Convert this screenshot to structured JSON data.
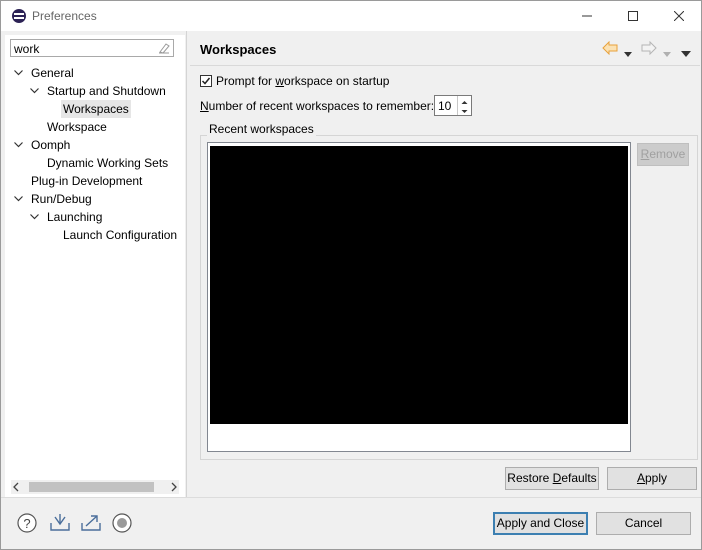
{
  "window": {
    "title": "Preferences"
  },
  "filter": {
    "value": "work"
  },
  "tree": [
    {
      "label": "General",
      "expanded": true
    },
    {
      "label": "Startup and Shutdown",
      "expanded": true
    },
    {
      "label": "Workspaces",
      "selected": true
    },
    {
      "label": "Workspace"
    },
    {
      "label": "Oomph",
      "expanded": true
    },
    {
      "label": "Dynamic Working Sets"
    },
    {
      "label": "Plug-in Development"
    },
    {
      "label": "Run/Debug",
      "expanded": true
    },
    {
      "label": "Launching",
      "expanded": true
    },
    {
      "label": "Launch Configuration"
    }
  ],
  "page": {
    "title": "Workspaces",
    "prompt_label_pre": "Prompt for ",
    "prompt_label_mnemonic": "w",
    "prompt_label_post": "orkspace on startup",
    "prompt_checked": true,
    "recent_label_mnemonic": "N",
    "recent_label_post": "umber of recent workspaces to remember:",
    "recent_count": "10",
    "recent_group_label": "Recent workspaces",
    "remove_mnemonic": "R",
    "remove_post": "emove",
    "restore_pre": "Restore ",
    "restore_mnemonic": "D",
    "restore_post": "efaults",
    "apply_mnemonic": "A",
    "apply_post": "pply"
  },
  "footer": {
    "apply_close_label": "Apply and Close",
    "cancel_label": "Cancel"
  },
  "colors": {
    "accent": "#3c7fb1",
    "nav_arrow": "#e8a13a",
    "selection": "#e6e6e6"
  }
}
